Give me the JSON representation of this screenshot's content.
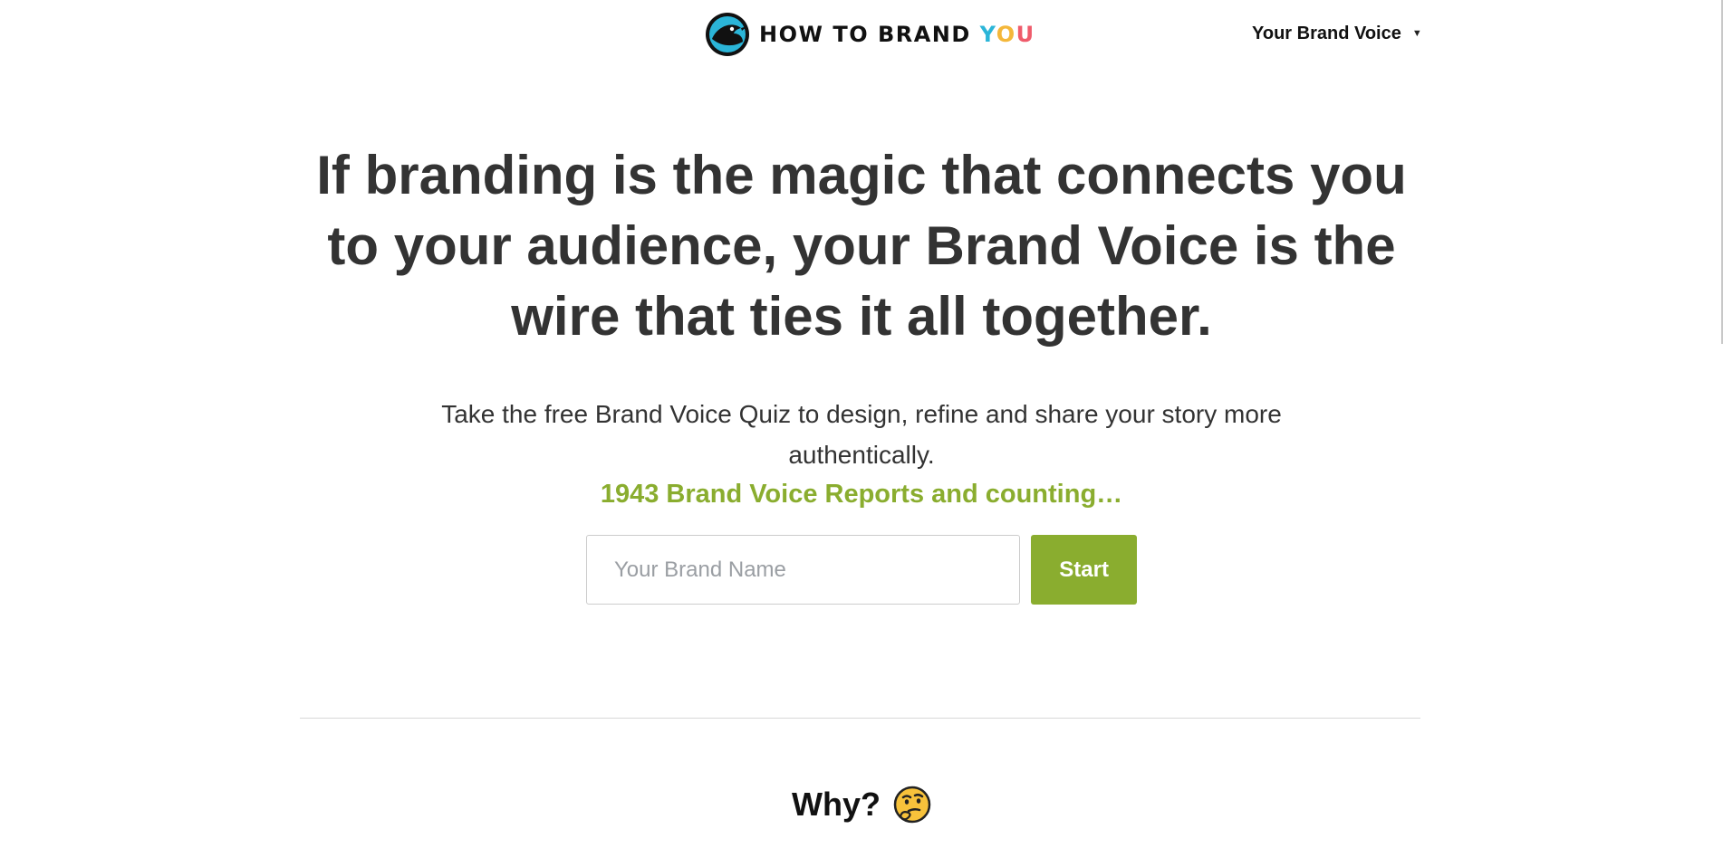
{
  "header": {
    "logo": {
      "text_part1": "HOW TO BRAND ",
      "text_y": "Y",
      "text_o": "O",
      "text_u": "U",
      "icon": "bird-logo-icon"
    },
    "nav": {
      "dropdown_label": "Your Brand Voice",
      "caret": "▼"
    }
  },
  "hero": {
    "headline": "If branding is the magic that connects you to your audience, your Brand Voice is the wire that ties it all together.",
    "subtext": "Take the free Brand Voice Quiz to design, refine and share your story more authentically.",
    "counter": "1943 Brand Voice Reports and counting…",
    "form": {
      "input_placeholder": "Your Brand Name",
      "input_value": "",
      "start_label": "Start"
    }
  },
  "why_section": {
    "title": "Why?",
    "icon": "thinking-face-icon"
  },
  "colors": {
    "accent_green": "#8aad2f",
    "text_dark": "#333333",
    "logo_y": "#2bb5d8",
    "logo_o": "#f4b73a",
    "logo_u": "#ef5b6b"
  }
}
